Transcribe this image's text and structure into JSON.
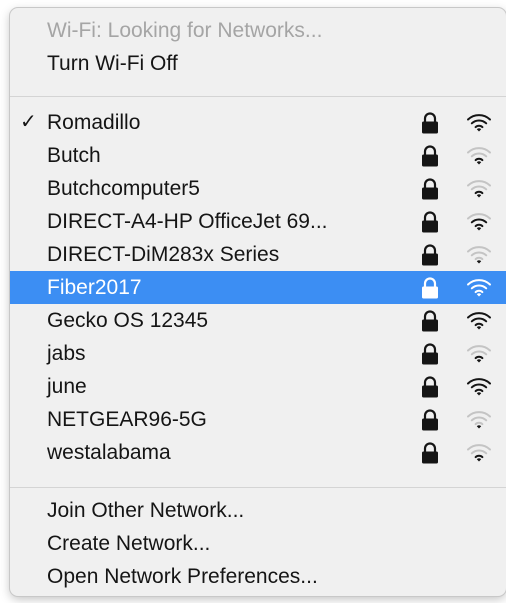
{
  "header": {
    "status": "Wi-Fi: Looking for Networks...",
    "toggle": "Turn Wi-Fi Off"
  },
  "networks": [
    {
      "name": "Romadillo",
      "connected": true,
      "locked": true,
      "signal": 3
    },
    {
      "name": "Butch",
      "connected": false,
      "locked": true,
      "signal": 1
    },
    {
      "name": "Butchcomputer5",
      "connected": false,
      "locked": true,
      "signal": 1
    },
    {
      "name": "DIRECT-A4-HP OfficeJet 69...",
      "connected": false,
      "locked": true,
      "signal": 2
    },
    {
      "name": "DIRECT-DiM283x Series",
      "connected": false,
      "locked": true,
      "signal": 0
    },
    {
      "name": "Fiber2017",
      "connected": false,
      "locked": true,
      "signal": 3,
      "highlighted": true
    },
    {
      "name": "Gecko OS 12345",
      "connected": false,
      "locked": true,
      "signal": 3
    },
    {
      "name": "jabs",
      "connected": false,
      "locked": true,
      "signal": 1
    },
    {
      "name": "june",
      "connected": false,
      "locked": true,
      "signal": 3
    },
    {
      "name": "NETGEAR96-5G",
      "connected": false,
      "locked": true,
      "signal": 0
    },
    {
      "name": "westalabama",
      "connected": false,
      "locked": true,
      "signal": 1
    }
  ],
  "checkmark": "✓",
  "footer": {
    "join": "Join Other Network...",
    "create": "Create Network...",
    "preferences": "Open Network Preferences..."
  },
  "colors": {
    "highlight": "#3c8ef3",
    "text": "#151515",
    "disabled": "#a5a5a5",
    "wifi_dim": "#c4c4c4",
    "wifi_dim_selected": "#9fc6f8"
  },
  "icons": {
    "lock": "lock-icon",
    "wifi": "wifi-signal-icon",
    "check": "checkmark-icon"
  }
}
